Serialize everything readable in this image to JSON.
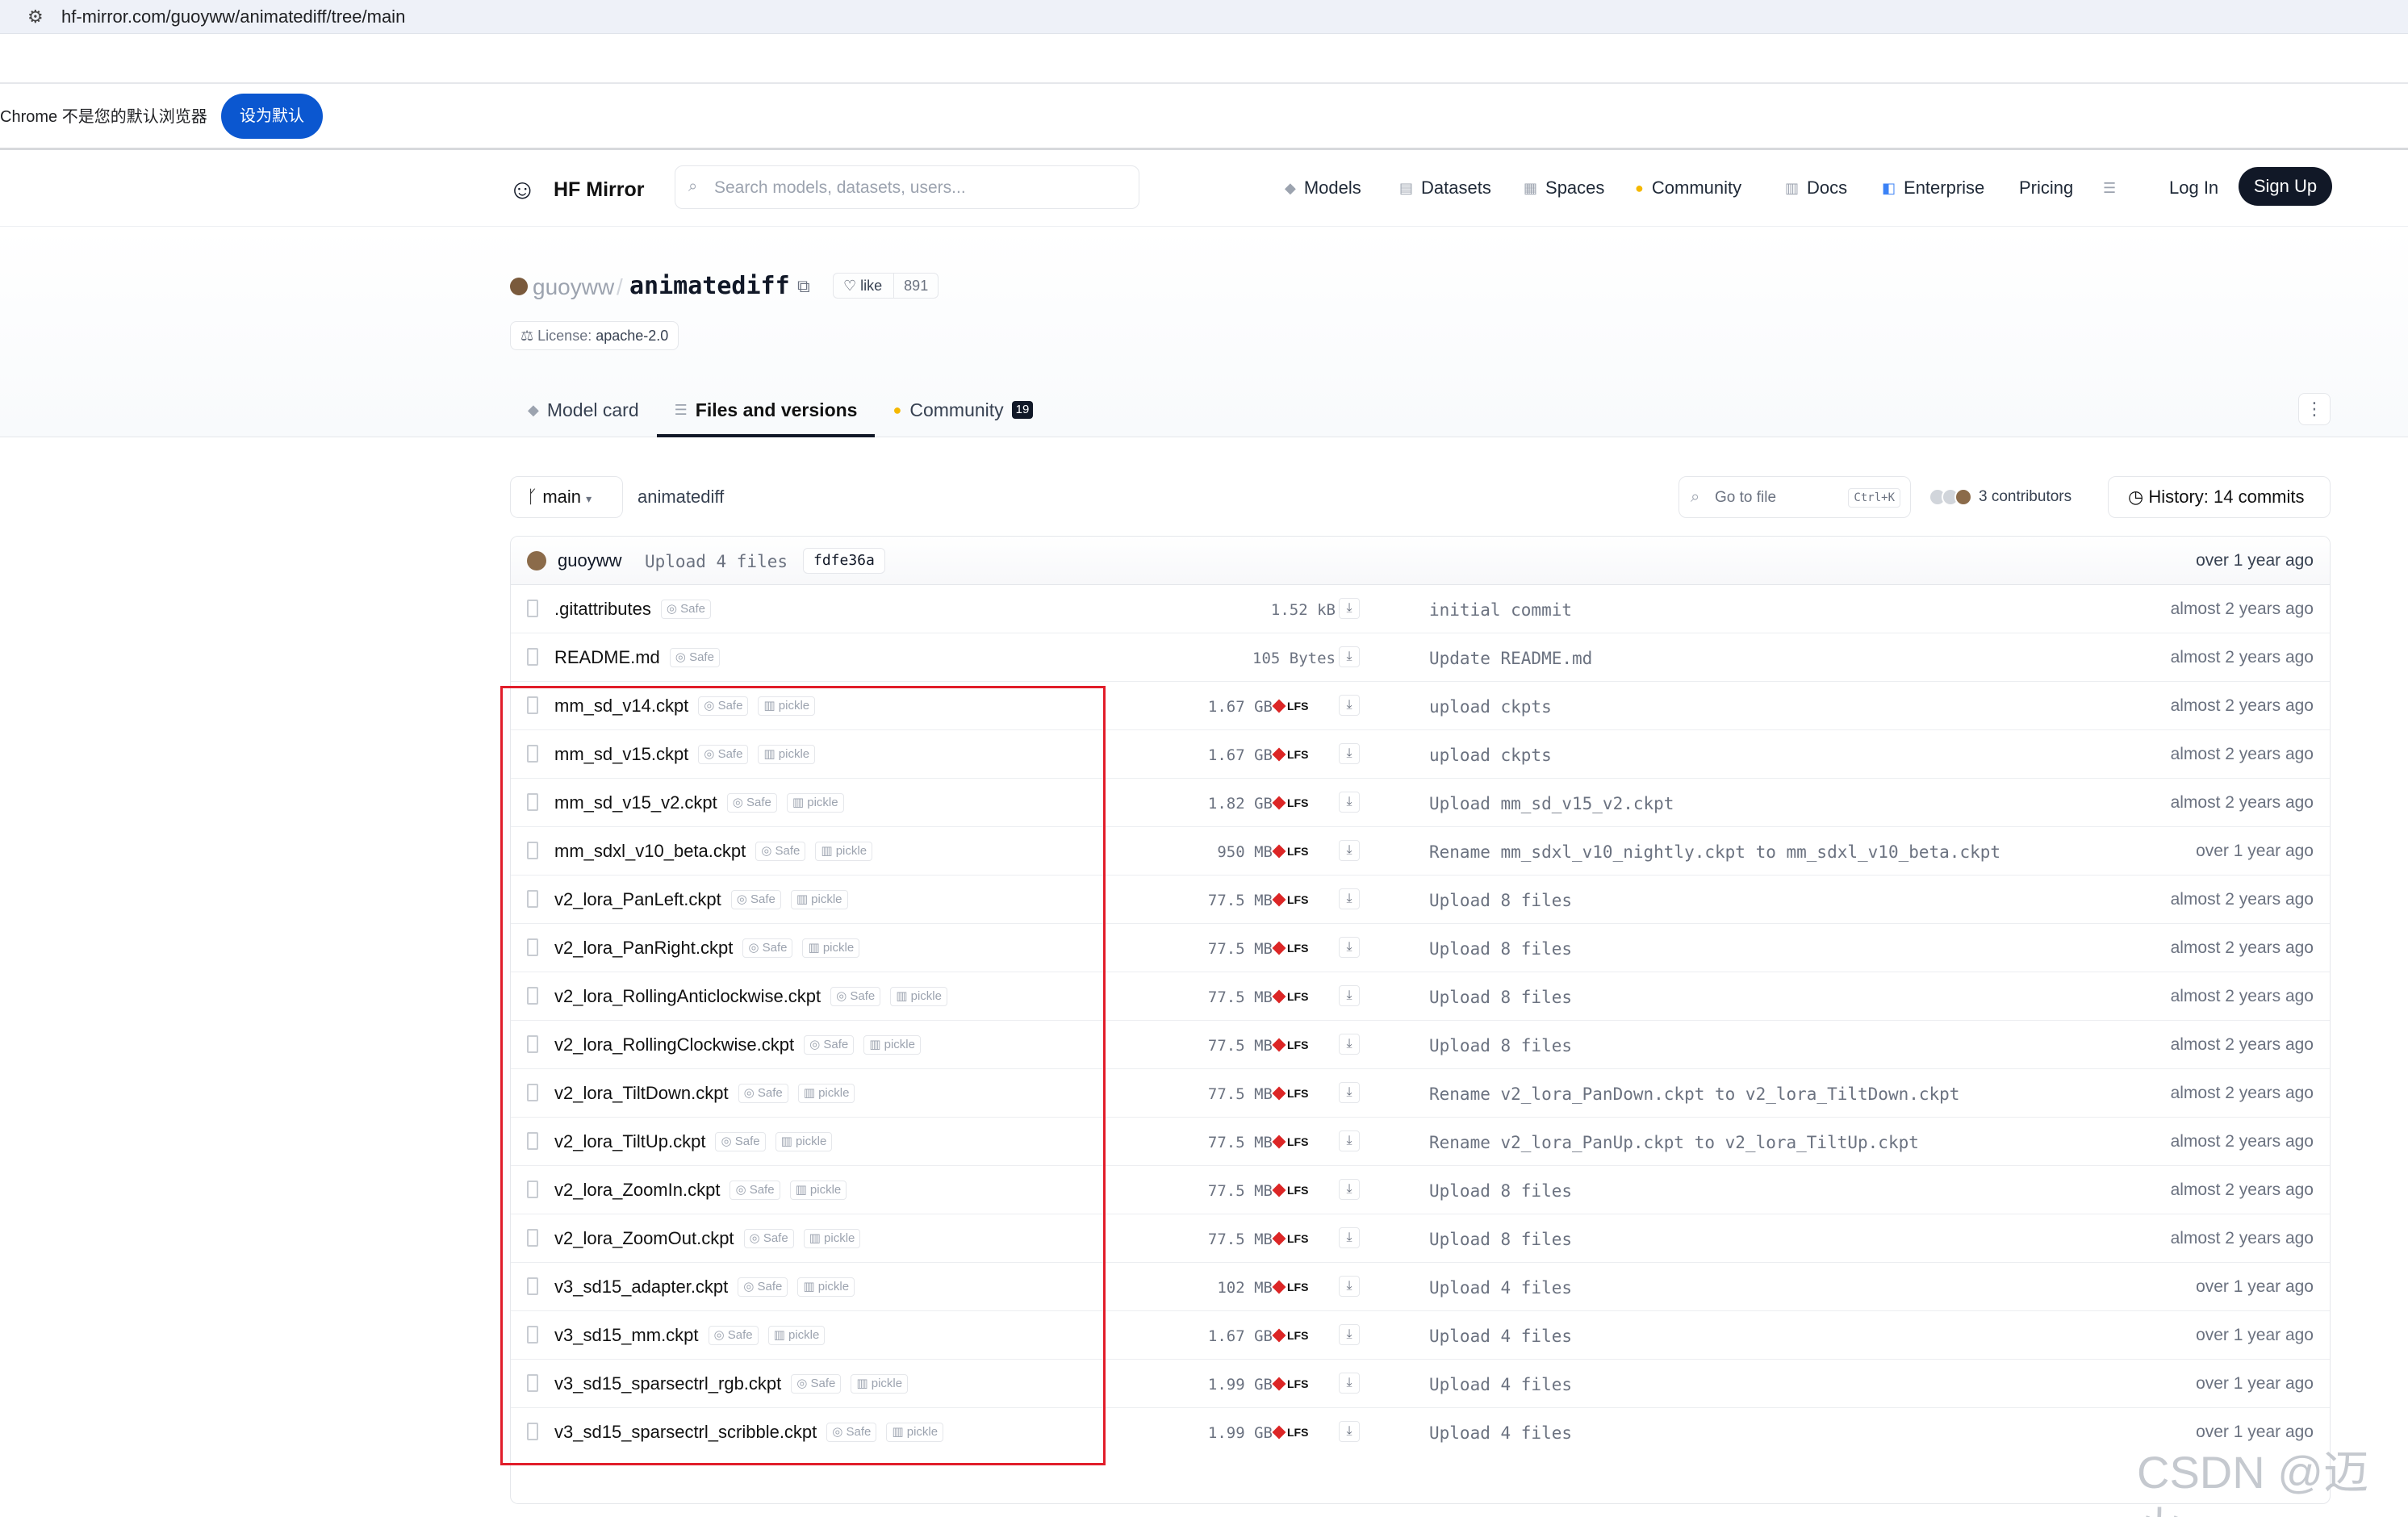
{
  "browser": {
    "url": "hf-mirror.com/guoyww/animatediff/tree/main",
    "infobar_message": "Chrome 不是您的默认浏览器",
    "set_default_label": "设为默认"
  },
  "header": {
    "brand": "HF Mirror",
    "search_placeholder": "Search models, datasets, users...",
    "nav": [
      "Models",
      "Datasets",
      "Spaces",
      "Community",
      "Docs",
      "Enterprise",
      "Pricing"
    ],
    "login": "Log In",
    "signup": "Sign Up"
  },
  "repo": {
    "owner": "guoyww",
    "slash": "/",
    "name": "animatediff",
    "like_label": "like",
    "like_count": "891",
    "license_label": "License:",
    "license_value": "apache-2.0",
    "tabs": [
      {
        "label": "Model card"
      },
      {
        "label": "Files and versions"
      },
      {
        "label": "Community",
        "badge": "19"
      }
    ]
  },
  "toolbar": {
    "branch": "main",
    "path": "animatediff",
    "goto_placeholder": "Go to file",
    "goto_shortcut": "Ctrl+K",
    "contributors": "3 contributors",
    "history": "History: 14 commits"
  },
  "last_commit": {
    "user": "guoyww",
    "message": "Upload 4 files",
    "hash": "fdfe36a",
    "time": "over 1 year ago"
  },
  "files": [
    {
      "name": ".gitattributes",
      "safe": "Safe",
      "pickle": "",
      "size": "1.52 kB",
      "lfs": "",
      "message": "initial commit",
      "time": "almost 2 years ago"
    },
    {
      "name": "README.md",
      "safe": "Safe",
      "pickle": "",
      "size": "105 Bytes",
      "lfs": "",
      "message": "Update README.md",
      "time": "almost 2 years ago"
    },
    {
      "name": "mm_sd_v14.ckpt",
      "safe": "Safe",
      "pickle": "pickle",
      "size": "1.67 GB",
      "lfs": "LFS",
      "message": "upload ckpts",
      "time": "almost 2 years ago"
    },
    {
      "name": "mm_sd_v15.ckpt",
      "safe": "Safe",
      "pickle": "pickle",
      "size": "1.67 GB",
      "lfs": "LFS",
      "message": "upload ckpts",
      "time": "almost 2 years ago"
    },
    {
      "name": "mm_sd_v15_v2.ckpt",
      "safe": "Safe",
      "pickle": "pickle",
      "size": "1.82 GB",
      "lfs": "LFS",
      "message": "Upload mm_sd_v15_v2.ckpt",
      "time": "almost 2 years ago"
    },
    {
      "name": "mm_sdxl_v10_beta.ckpt",
      "safe": "Safe",
      "pickle": "pickle",
      "size": "950 MB",
      "lfs": "LFS",
      "message": "Rename mm_sdxl_v10_nightly.ckpt to mm_sdxl_v10_beta.ckpt",
      "time": "over 1 year ago"
    },
    {
      "name": "v2_lora_PanLeft.ckpt",
      "safe": "Safe",
      "pickle": "pickle",
      "size": "77.5 MB",
      "lfs": "LFS",
      "message": "Upload 8 files",
      "time": "almost 2 years ago"
    },
    {
      "name": "v2_lora_PanRight.ckpt",
      "safe": "Safe",
      "pickle": "pickle",
      "size": "77.5 MB",
      "lfs": "LFS",
      "message": "Upload 8 files",
      "time": "almost 2 years ago"
    },
    {
      "name": "v2_lora_RollingAnticlockwise.ckpt",
      "safe": "Safe",
      "pickle": "pickle",
      "size": "77.5 MB",
      "lfs": "LFS",
      "message": "Upload 8 files",
      "time": "almost 2 years ago"
    },
    {
      "name": "v2_lora_RollingClockwise.ckpt",
      "safe": "Safe",
      "pickle": "pickle",
      "size": "77.5 MB",
      "lfs": "LFS",
      "message": "Upload 8 files",
      "time": "almost 2 years ago"
    },
    {
      "name": "v2_lora_TiltDown.ckpt",
      "safe": "Safe",
      "pickle": "pickle",
      "size": "77.5 MB",
      "lfs": "LFS",
      "message": "Rename v2_lora_PanDown.ckpt to v2_lora_TiltDown.ckpt",
      "time": "almost 2 years ago"
    },
    {
      "name": "v2_lora_TiltUp.ckpt",
      "safe": "Safe",
      "pickle": "pickle",
      "size": "77.5 MB",
      "lfs": "LFS",
      "message": "Rename v2_lora_PanUp.ckpt to v2_lora_TiltUp.ckpt",
      "time": "almost 2 years ago"
    },
    {
      "name": "v2_lora_ZoomIn.ckpt",
      "safe": "Safe",
      "pickle": "pickle",
      "size": "77.5 MB",
      "lfs": "LFS",
      "message": "Upload 8 files",
      "time": "almost 2 years ago"
    },
    {
      "name": "v2_lora_ZoomOut.ckpt",
      "safe": "Safe",
      "pickle": "pickle",
      "size": "77.5 MB",
      "lfs": "LFS",
      "message": "Upload 8 files",
      "time": "almost 2 years ago"
    },
    {
      "name": "v3_sd15_adapter.ckpt",
      "safe": "Safe",
      "pickle": "pickle",
      "size": "102 MB",
      "lfs": "LFS",
      "message": "Upload 4 files",
      "time": "over 1 year ago"
    },
    {
      "name": "v3_sd15_mm.ckpt",
      "safe": "Safe",
      "pickle": "pickle",
      "size": "1.67 GB",
      "lfs": "LFS",
      "message": "Upload 4 files",
      "time": "over 1 year ago"
    },
    {
      "name": "v3_sd15_sparsectrl_rgb.ckpt",
      "safe": "Safe",
      "pickle": "pickle",
      "size": "1.99 GB",
      "lfs": "LFS",
      "message": "Upload 4 files",
      "time": "over 1 year ago"
    },
    {
      "name": "v3_sd15_sparsectrl_scribble.ckpt",
      "safe": "Safe",
      "pickle": "pickle",
      "size": "1.99 GB",
      "lfs": "LFS",
      "message": "Upload 4 files",
      "time": "over 1 year ago"
    }
  ],
  "watermark": "CSDN @迈火",
  "colors": {
    "accent_blue": "#0b57d0",
    "annotation_red": "#e11d2a",
    "lfs_red": "#dc2626"
  }
}
